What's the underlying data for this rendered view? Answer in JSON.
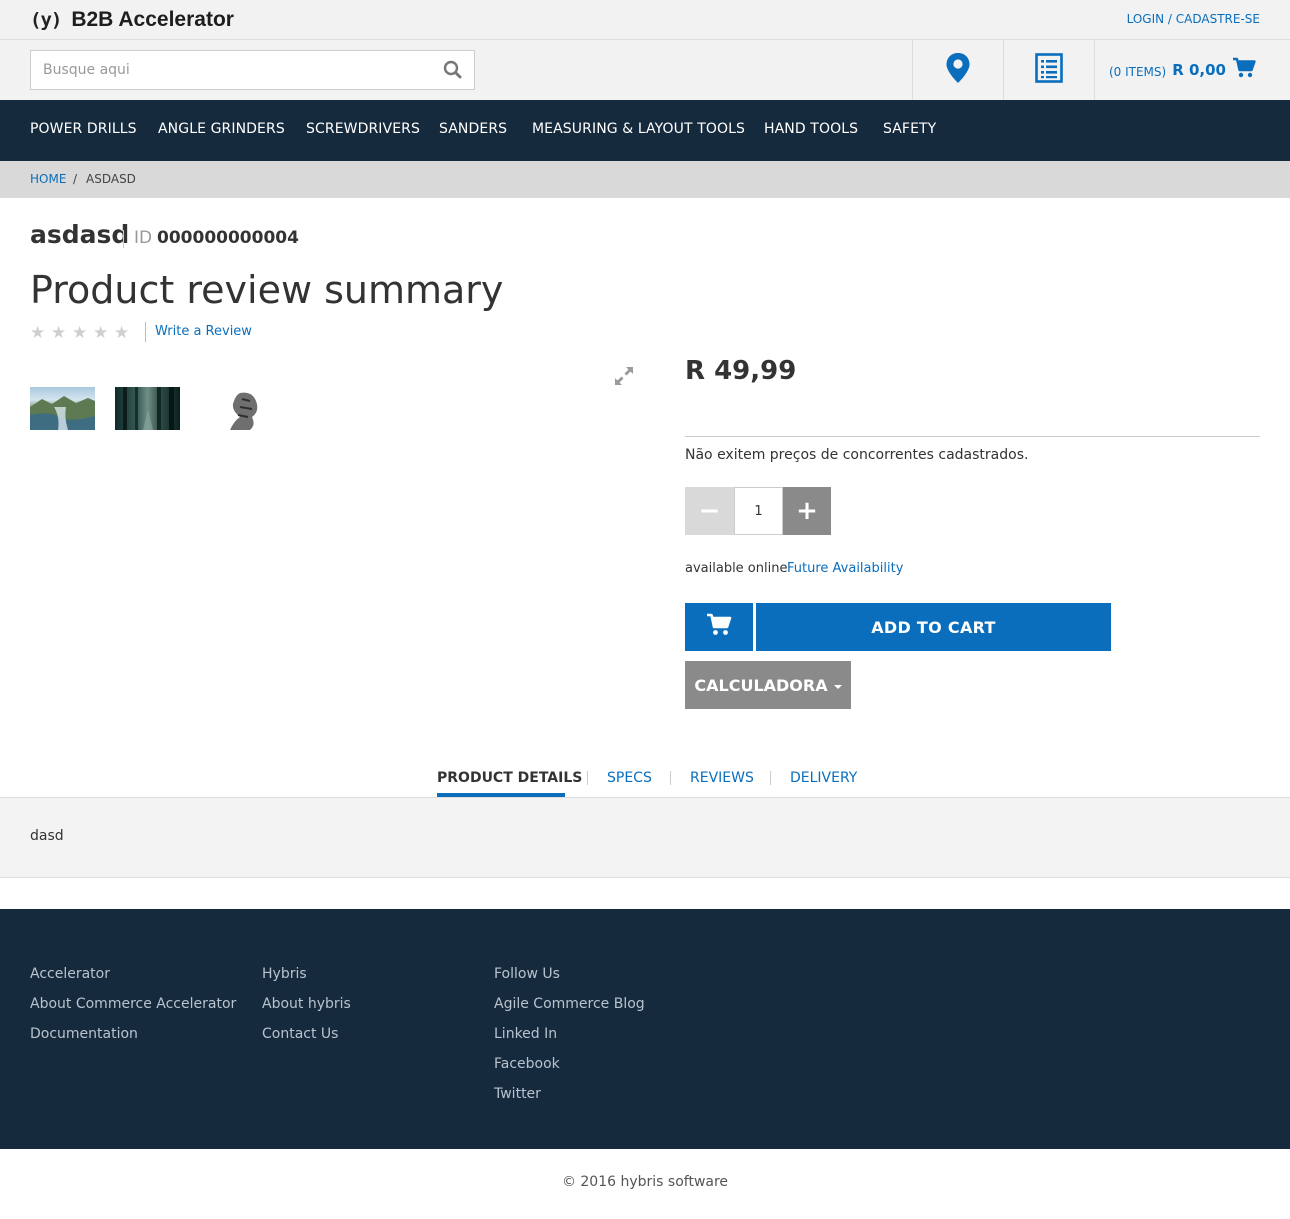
{
  "header": {
    "logo_mark": "(y)",
    "logo_text": "B2B Accelerator",
    "login_label": "LOGIN / CADASTRE-SE",
    "search_placeholder": "Busque aqui",
    "cart_count": "(0 ITEMS)",
    "cart_total": "R 0,00",
    "icons": [
      "search-icon",
      "location-pin-icon",
      "order-form-icon",
      "cart-icon"
    ],
    "accent_color": "#0a6ebd"
  },
  "nav": {
    "items": [
      "POWER DRILLS",
      "ANGLE GRINDERS",
      "SCREWDRIVERS",
      "SANDERS",
      "MEASURING & LAYOUT TOOLS",
      "HAND TOOLS",
      "SAFETY"
    ],
    "background": "#162a3e"
  },
  "breadcrumb": {
    "home": "HOME",
    "separator": "/",
    "current": "ASDASD"
  },
  "product": {
    "name": "asdasd",
    "id_label": "ID",
    "id_value": "000000000004",
    "review_title": "Product review summary",
    "rating_stars": 0,
    "rating_max": 5,
    "write_review": "Write a Review",
    "price": "R 49,99",
    "competitor_note": "Não exitem preços de concorrentes cadastrados.",
    "qty_minus": "−",
    "quantity": "1",
    "qty_plus": "+",
    "available_online": "available online",
    "future_availability": "Future Availability",
    "add_to_cart": "ADD TO CART",
    "calculator": "CALCULADORA",
    "thumbnails": [
      "lake-landscape-thumbnail",
      "forest-thumbnail",
      "sketch-figure-thumbnail"
    ]
  },
  "tabs": {
    "items": [
      "PRODUCT DETAILS",
      "SPECS",
      "REVIEWS",
      "DELIVERY"
    ],
    "active": "PRODUCT DETAILS",
    "content": "dasd"
  },
  "footer": {
    "col1": {
      "heading": "Accelerator",
      "links": [
        "About Commerce Accelerator",
        "Documentation"
      ]
    },
    "col2": {
      "heading": "Hybris",
      "links": [
        "About hybris",
        "Contact Us"
      ]
    },
    "col3": {
      "heading": "Follow Us",
      "links": [
        "Agile Commerce Blog",
        "Linked In",
        "Facebook",
        "Twitter"
      ]
    },
    "copyright": "© 2016 hybris software"
  }
}
